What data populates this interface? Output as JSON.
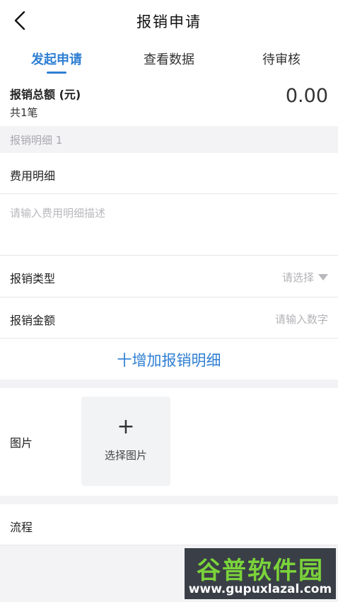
{
  "header": {
    "title": "报销申请",
    "back_icon": "chevron-left-icon"
  },
  "tabs": [
    {
      "label": "发起申请",
      "active": true
    },
    {
      "label": "查看数据",
      "active": false
    },
    {
      "label": "待审核",
      "active": false
    }
  ],
  "summary": {
    "label": "报销总额 (元)",
    "count": "共1笔",
    "amount": "0.00"
  },
  "detail": {
    "header": "报销明细 1",
    "description_label": "费用明细",
    "description_placeholder": "请输入费用明细描述",
    "type_label": "报销类型",
    "type_value": "请选择",
    "amount_label": "报销金额",
    "amount_placeholder": "请输入数字"
  },
  "add_detail": "十增加报销明细",
  "image": {
    "label": "图片",
    "plus": "+",
    "picker_label": "选择图片"
  },
  "flow": {
    "label": "流程"
  },
  "watermark": {
    "top": "谷普软件园",
    "bottom": "www.gupuxlazal.com"
  },
  "colors": {
    "accent": "#2f7fd3",
    "background": "#f3f3f5",
    "placeholder": "#b8b8bd"
  }
}
